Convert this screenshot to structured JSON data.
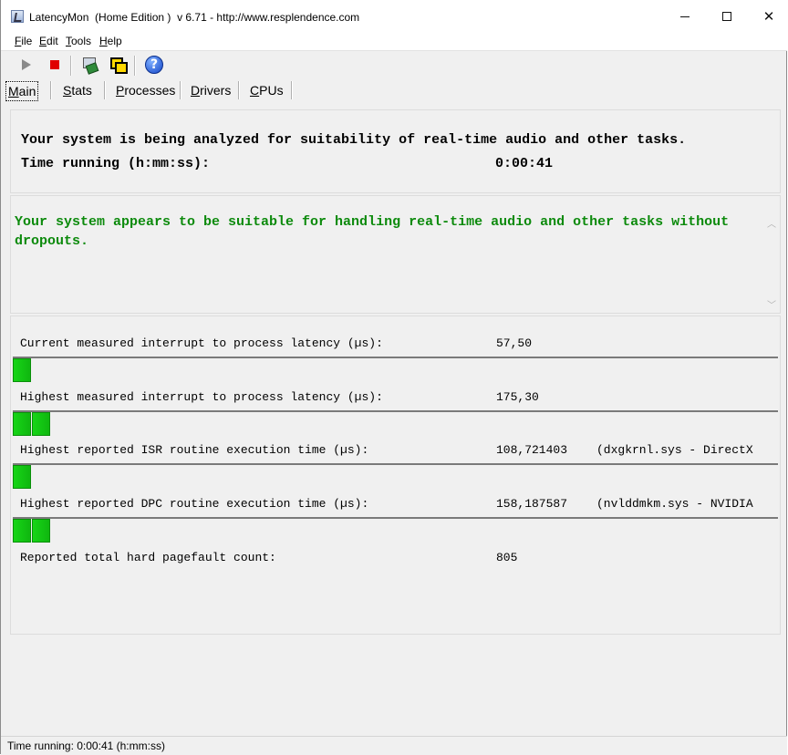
{
  "window": {
    "title": "LatencyMon  (Home Edition )  v 6.71 - http://www.resplendence.com"
  },
  "menu": {
    "items": [
      {
        "key": "F",
        "rest": "ile"
      },
      {
        "key": "E",
        "rest": "dit"
      },
      {
        "key": "T",
        "rest": "ools"
      },
      {
        "key": "H",
        "rest": "elp"
      }
    ]
  },
  "toolbar": {
    "icons": [
      "play-icon",
      "stop-icon",
      "machine-icon",
      "windows-icon",
      "help-icon"
    ],
    "help_glyph": "?"
  },
  "tabs": [
    {
      "key": "M",
      "rest": "ain",
      "active": true
    },
    {
      "key": "S",
      "rest": "tats"
    },
    {
      "key": "P",
      "rest": "rocesses"
    },
    {
      "key": "D",
      "rest": "rivers"
    },
    {
      "key": "C",
      "rest": "PUs"
    }
  ],
  "summary": {
    "line1": "Your system is being analyzed for suitability of real-time audio and other tasks.",
    "time_label": "Time running (h:mm:ss):",
    "time_value": "0:00:41"
  },
  "verdict": {
    "text": "Your system appears to be suitable for handling real-time audio and other tasks without dropouts.",
    "color": "#0c8a0c"
  },
  "metrics": {
    "current_latency": {
      "label": "Current measured interrupt to process latency (µs):",
      "value": "57,50",
      "bar_segments": 1
    },
    "highest_latency": {
      "label": "Highest measured interrupt to process latency (µs):",
      "value": "175,30",
      "bar_segments": 2
    },
    "highest_isr": {
      "label": "Highest reported ISR routine execution time (µs):",
      "value": "108,721403",
      "detail": "(dxgkrnl.sys - DirectX",
      "bar_segments": 1
    },
    "highest_dpc": {
      "label": "Highest reported DPC routine execution time (µs):",
      "value": "158,187587",
      "detail": "(nvlddmkm.sys - NVIDIA",
      "bar_segments": 2
    },
    "pagefaults": {
      "label": "Reported total hard pagefault count:",
      "value": "805"
    }
  },
  "status": {
    "text": "Time running: 0:00:41  (h:mm:ss)"
  },
  "colors": {
    "bar_green": "#17d717",
    "stop_red": "#e00000"
  }
}
